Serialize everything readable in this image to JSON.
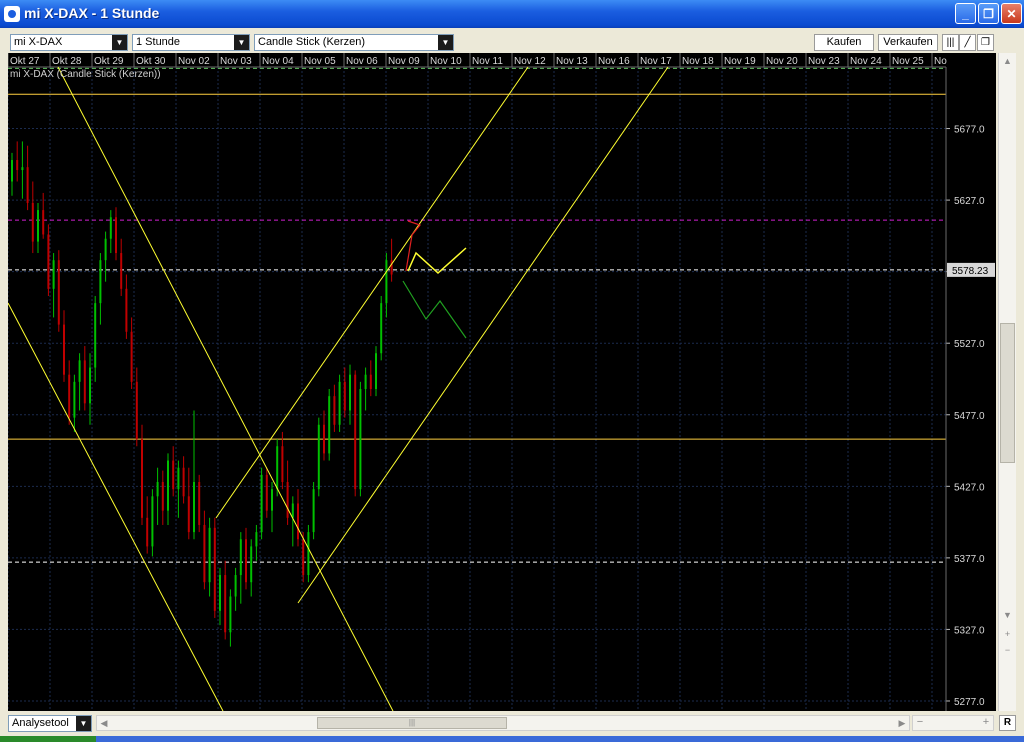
{
  "window": {
    "title": "mi X-DAX - 1 Stunde",
    "buttons": {
      "minimize": "_",
      "restore": "❐",
      "close": "✕"
    }
  },
  "toolbar": {
    "instrument": "mi X-DAX",
    "interval": "1 Stunde",
    "chart_type": "Candle Stick (Kerzen)",
    "buy": "Kaufen",
    "sell": "Verkaufen"
  },
  "footer": {
    "analysis_tool": "Analysetool",
    "reset": "R"
  },
  "colors": {
    "background": "#000000",
    "grid": "#1b2b4e",
    "up": "#00c000",
    "down": "#c00000",
    "trendline": "#ffff30",
    "level_line": "#ffd040",
    "magenta_level": "#d020d0",
    "current_price": "#ffffff",
    "resistance_dashed": "#60c060"
  },
  "chart_data": {
    "type": "candlestick",
    "title": "mi X-DAX (Candle Stick (Kerzen))",
    "x_ticks": [
      "Okt 27",
      "Okt 28",
      "Okt 29",
      "Okt 30",
      "Nov 02",
      "Nov 03",
      "Nov 04",
      "Nov 05",
      "Nov 06",
      "Nov 09",
      "Nov 10",
      "Nov 11",
      "Nov 12",
      "Nov 13",
      "Nov 16",
      "Nov 17",
      "Nov 18",
      "Nov 19",
      "Nov 20",
      "Nov 23",
      "Nov 24",
      "Nov 25",
      "No"
    ],
    "y_ticks": [
      "5677.0",
      "5627.0",
      "5577.0",
      "5527.0",
      "5477.0",
      "5427.0",
      "5377.0",
      "5327.0",
      "5277.0"
    ],
    "y_tick_values": [
      5677,
      5627,
      5577,
      5527,
      5477,
      5427,
      5377,
      5327,
      5277
    ],
    "ylim": [
      5270,
      5720
    ],
    "current_price": "5578.23",
    "horizontal_levels": [
      {
        "value": 5701,
        "style": "solid",
        "color": "yellow"
      },
      {
        "value": 5719,
        "style": "dashed",
        "color": "green"
      },
      {
        "value": 5613,
        "style": "dashed",
        "color": "magenta"
      },
      {
        "value": 5578.23,
        "style": "dashed",
        "color": "white"
      },
      {
        "value": 5460,
        "style": "solid",
        "color": "yellow"
      },
      {
        "value": 5374,
        "style": "dashed",
        "color": "white"
      }
    ],
    "candles": [
      [
        0,
        5640,
        5660,
        5630,
        5655
      ],
      [
        0.4,
        5655,
        5668,
        5640,
        5648
      ],
      [
        0.8,
        5648,
        5668,
        5628,
        5650
      ],
      [
        1.2,
        5650,
        5665,
        5620,
        5625
      ],
      [
        1.6,
        5625,
        5640,
        5590,
        5598
      ],
      [
        2.0,
        5598,
        5625,
        5590,
        5620
      ],
      [
        2.4,
        5620,
        5632,
        5600,
        5603
      ],
      [
        2.8,
        5603,
        5610,
        5560,
        5565
      ],
      [
        3.2,
        5565,
        5590,
        5545,
        5585
      ],
      [
        3.6,
        5585,
        5592,
        5535,
        5540
      ],
      [
        4.0,
        5540,
        5550,
        5500,
        5505
      ],
      [
        4.4,
        5505,
        5515,
        5470,
        5475
      ],
      [
        4.8,
        5475,
        5505,
        5465,
        5500
      ],
      [
        5.2,
        5500,
        5520,
        5480,
        5515
      ],
      [
        5.6,
        5515,
        5525,
        5480,
        5485
      ],
      [
        6.0,
        5485,
        5520,
        5470,
        5510
      ],
      [
        6.4,
        5510,
        5560,
        5500,
        5555
      ],
      [
        6.8,
        5555,
        5590,
        5540,
        5585
      ],
      [
        7.2,
        5585,
        5605,
        5570,
        5600
      ],
      [
        7.6,
        5600,
        5620,
        5590,
        5615
      ],
      [
        8.0,
        5615,
        5622,
        5585,
        5590
      ],
      [
        8.4,
        5590,
        5600,
        5560,
        5565
      ],
      [
        8.8,
        5565,
        5575,
        5530,
        5535
      ],
      [
        9.2,
        5535,
        5545,
        5495,
        5500
      ],
      [
        9.6,
        5500,
        5510,
        5455,
        5460
      ],
      [
        10.0,
        5460,
        5470,
        5400,
        5405
      ],
      [
        10.4,
        5405,
        5420,
        5380,
        5385
      ],
      [
        10.8,
        5385,
        5425,
        5378,
        5420
      ],
      [
        11.2,
        5420,
        5440,
        5400,
        5430
      ],
      [
        11.6,
        5430,
        5438,
        5400,
        5410
      ],
      [
        12.0,
        5410,
        5450,
        5400,
        5445
      ],
      [
        12.4,
        5445,
        5455,
        5420,
        5425
      ],
      [
        12.8,
        5425,
        5445,
        5405,
        5440
      ],
      [
        13.2,
        5440,
        5448,
        5415,
        5420
      ],
      [
        13.6,
        5420,
        5440,
        5390,
        5395
      ],
      [
        14.0,
        5395,
        5480,
        5390,
        5430
      ],
      [
        14.4,
        5430,
        5435,
        5395,
        5400
      ],
      [
        14.8,
        5400,
        5410,
        5355,
        5360
      ],
      [
        15.2,
        5360,
        5405,
        5350,
        5398
      ],
      [
        15.6,
        5398,
        5405,
        5335,
        5340
      ],
      [
        16.0,
        5340,
        5370,
        5330,
        5365
      ],
      [
        16.4,
        5365,
        5375,
        5320,
        5325
      ],
      [
        16.8,
        5325,
        5355,
        5315,
        5350
      ],
      [
        17.2,
        5350,
        5370,
        5340,
        5365
      ],
      [
        17.6,
        5365,
        5395,
        5345,
        5390
      ],
      [
        18.0,
        5390,
        5398,
        5355,
        5360
      ],
      [
        18.4,
        5360,
        5390,
        5350,
        5385
      ],
      [
        18.8,
        5385,
        5400,
        5375,
        5395
      ],
      [
        19.2,
        5395,
        5440,
        5390,
        5435
      ],
      [
        19.6,
        5435,
        5440,
        5405,
        5410
      ],
      [
        20.0,
        5410,
        5430,
        5395,
        5425
      ],
      [
        20.4,
        5425,
        5460,
        5420,
        5455
      ],
      [
        20.8,
        5455,
        5465,
        5425,
        5430
      ],
      [
        21.2,
        5430,
        5445,
        5400,
        5405
      ],
      [
        21.6,
        5405,
        5420,
        5385,
        5415
      ],
      [
        22.0,
        5415,
        5425,
        5385,
        5390
      ],
      [
        22.4,
        5390,
        5395,
        5360,
        5365
      ],
      [
        22.8,
        5365,
        5400,
        5360,
        5395
      ],
      [
        23.2,
        5395,
        5430,
        5390,
        5425
      ],
      [
        23.6,
        5425,
        5475,
        5420,
        5470
      ],
      [
        24.0,
        5470,
        5480,
        5445,
        5450
      ],
      [
        24.4,
        5450,
        5495,
        5445,
        5490
      ],
      [
        24.8,
        5490,
        5498,
        5465,
        5470
      ],
      [
        25.2,
        5470,
        5505,
        5465,
        5500
      ],
      [
        25.6,
        5500,
        5510,
        5475,
        5480
      ],
      [
        26.0,
        5480,
        5512,
        5470,
        5505
      ],
      [
        26.4,
        5505,
        5508,
        5420,
        5425
      ],
      [
        26.8,
        5425,
        5500,
        5420,
        5495
      ],
      [
        27.2,
        5495,
        5510,
        5480,
        5505
      ],
      [
        27.6,
        5505,
        5515,
        5490,
        5495
      ],
      [
        28.0,
        5495,
        5525,
        5490,
        5520
      ],
      [
        28.4,
        5520,
        5560,
        5515,
        5555
      ],
      [
        28.8,
        5555,
        5590,
        5545,
        5585
      ],
      [
        29.2,
        5585,
        5600,
        5570,
        5575
      ]
    ],
    "trendlines": [
      {
        "from": [
          0,
          5655
        ],
        "to": [
          11,
          5350
        ],
        "note": "upper falling"
      },
      {
        "from": [
          -1,
          5555
        ],
        "to": [
          7,
          5280
        ],
        "note": "lower falling"
      },
      {
        "from": [
          12,
          5315
        ],
        "to": [
          8,
          5720
        ],
        "note": ""
      }
    ]
  }
}
